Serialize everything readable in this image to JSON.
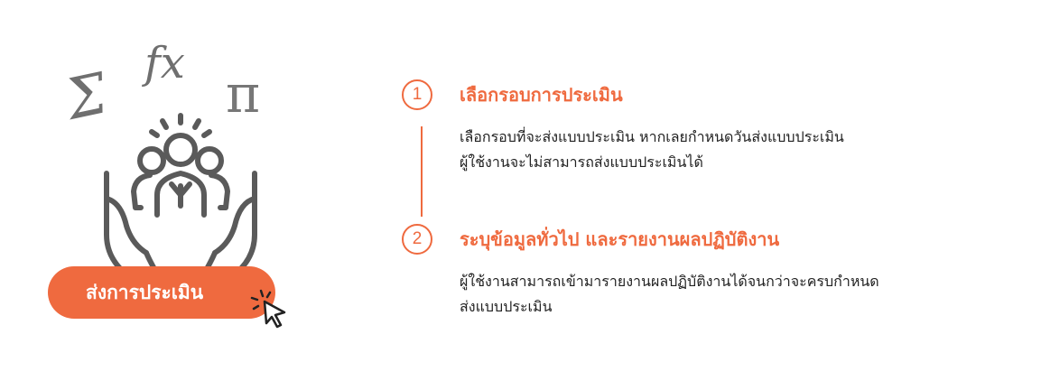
{
  "illustration": {
    "symbols": {
      "sigma": "Σ",
      "fx": "fx",
      "pi": "π"
    }
  },
  "cta": {
    "label": "ส่งการประเมิน"
  },
  "colors": {
    "accent": "#ef6a3f",
    "icon_gray": "#5a5a5a"
  },
  "steps": [
    {
      "number": "1",
      "title": "เลือกรอบการประเมิน",
      "desc_line1": "เลือกรอบที่จะส่งแบบประเมิน หากเลยกำหนดวันส่งแบบประเมิน",
      "desc_line2": "ผู้ใช้งานจะไม่สามารถส่งแบบประเมินได้"
    },
    {
      "number": "2",
      "title": "ระบุข้อมูลทั่วไป และรายงานผลปฏิบัติงาน",
      "desc_line1": "ผู้ใช้งานสามารถเข้ามารายงานผลปฏิบัติงานได้จนกว่าจะครบกำหนด",
      "desc_line2": "ส่งแบบประเมิน"
    }
  ]
}
